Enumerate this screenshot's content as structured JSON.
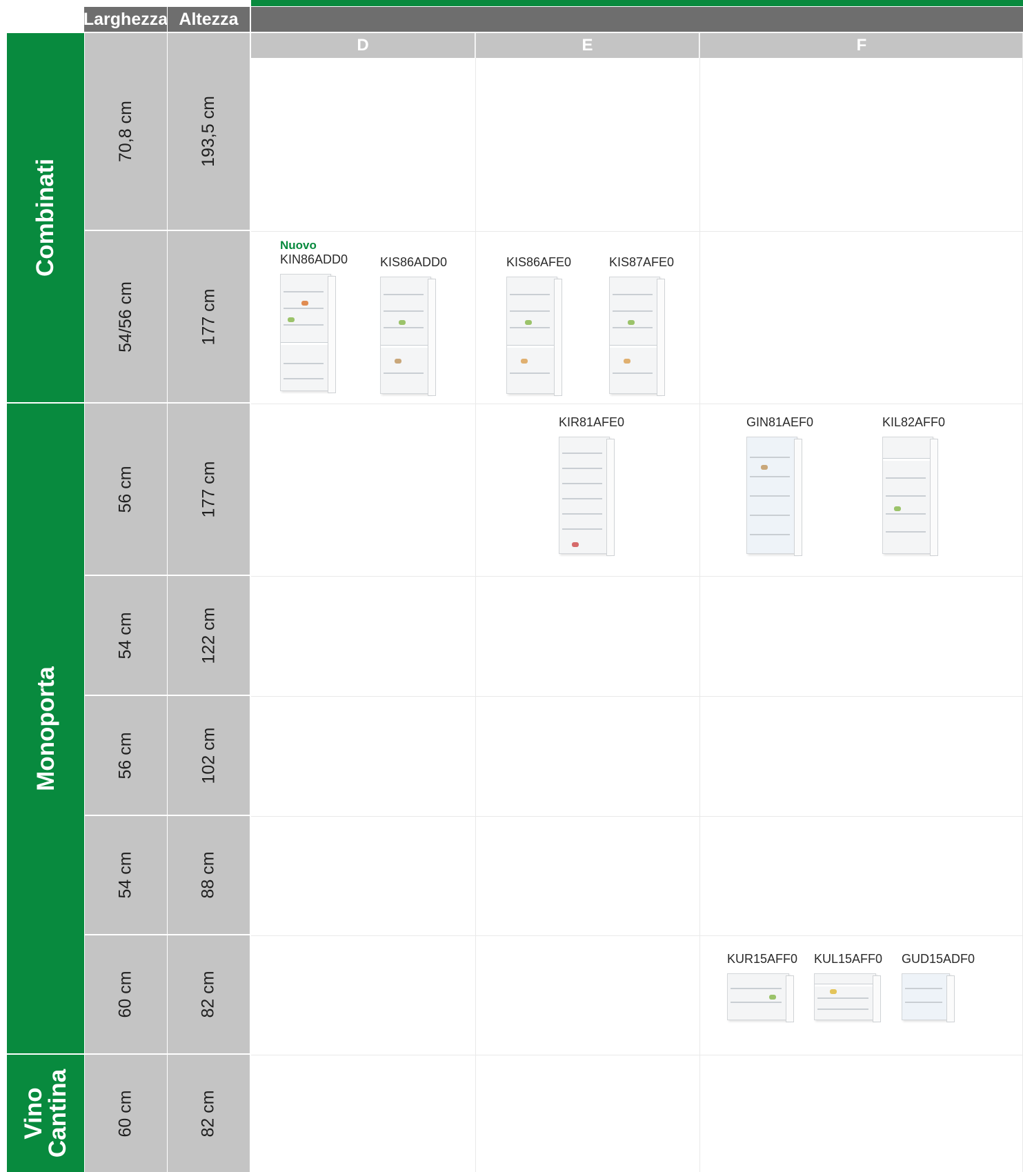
{
  "header": {
    "width_label": "Larghezza",
    "height_label": "Altezza",
    "classes": [
      "D",
      "E",
      "F"
    ]
  },
  "categories": [
    {
      "label": "Combinati"
    },
    {
      "label": "Monoporta"
    },
    {
      "label": "Vino Cantina"
    }
  ],
  "rows": [
    {
      "width": "70,8 cm",
      "height": "193,5 cm"
    },
    {
      "width": "54/56 cm",
      "height": "177 cm"
    },
    {
      "width": "56 cm",
      "height": "177 cm"
    },
    {
      "width": "54 cm",
      "height": "122 cm"
    },
    {
      "width": "56 cm",
      "height": "102 cm"
    },
    {
      "width": "54 cm",
      "height": "88 cm"
    },
    {
      "width": "60 cm",
      "height": "82 cm"
    },
    {
      "width": "60 cm",
      "height": "82 cm"
    }
  ],
  "products": {
    "r2_d_1": {
      "badge": "Nuovo",
      "code": "KIN86ADD0"
    },
    "r2_d_2": {
      "code": "KIS86ADD0"
    },
    "r2_e_1": {
      "code": "KIS86AFE0"
    },
    "r2_e_2": {
      "code": "KIS87AFE0"
    },
    "r3_e_1": {
      "code": "KIR81AFE0"
    },
    "r3_f_1": {
      "code": "GIN81AEF0"
    },
    "r3_f_2": {
      "code": "KIL82AFF0"
    },
    "r7_f_1": {
      "code": "KUR15AFF0"
    },
    "r7_f_2": {
      "code": "KUL15AFF0"
    },
    "r7_f_3": {
      "code": "GUD15ADF0"
    }
  },
  "colors": {
    "brand_green": "#088a3e",
    "header_grey": "#6e6e6e",
    "cell_grey": "#c4c4c4"
  },
  "icons": {
    "fridge_combi": "fridge-freezer-icon",
    "fridge_tall": "fridge-icon",
    "freezer_tall": "freezer-icon",
    "fridge_under": "undercounter-fridge-icon"
  }
}
